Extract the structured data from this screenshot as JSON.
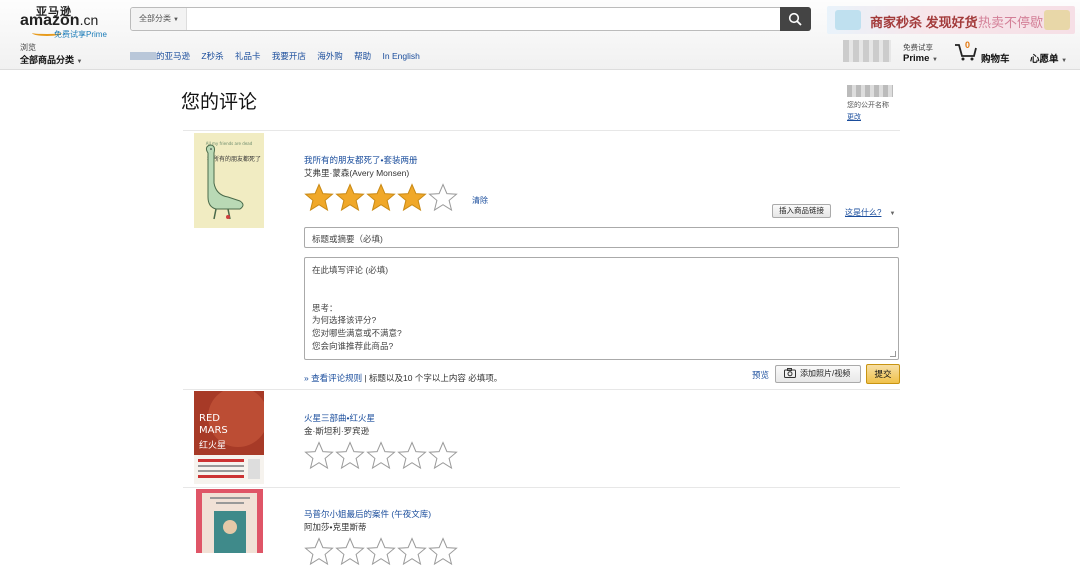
{
  "header": {
    "logo_cn": "亚马逊",
    "logo_brand": "amazon",
    "logo_tld": ".cn",
    "prime_trial": "免费试享Prime",
    "search_category": "全部分类",
    "search_placeholder": "",
    "banner_text_main": "商家秒杀 发现好货",
    "banner_text_sub": "热卖不停歇",
    "browse_small": "浏览",
    "browse_big": "全部商品分类",
    "nav_links": [
      "的亚马逊",
      "Z秒杀",
      "礼品卡",
      "我要开店",
      "海外购",
      "帮助",
      "In English"
    ],
    "prime_small": "免费试享",
    "prime_big": "Prime",
    "cart_count": "0",
    "cart_label": "购物车",
    "wishlist": "心愿单"
  },
  "page": {
    "title": "您的评论",
    "public_name_label": "您的公开名称",
    "public_name_edit": "更改"
  },
  "review_form": {
    "product_title": "我所有的朋友都死了•套装两册",
    "author": "艾弗里·蒙森(Avery Monsen)",
    "rating": 4,
    "max_rating": 5,
    "clear": "清除",
    "insert_link_button": "插入商品链接",
    "whats_this": "这是什么?",
    "title_placeholder": "标题或摘要（必填)",
    "body_lines": [
      "在此填写评论 (必填)",
      "",
      "",
      "思考：",
      "为何选择该评分?",
      "您对哪些满意或不满意?",
      "您会向谁推荐此商品?"
    ],
    "rules_link": "» 查看评论规则",
    "rules_text": "| 标题以及10 个字以上内容 必填项。",
    "preview": "预览",
    "add_photo_button": "添加照片/视频",
    "submit_button": "提交"
  },
  "products": [
    {
      "title": "火星三部曲•红火星",
      "author": "金·斯坦利·罗宾逊",
      "rating": 0
    },
    {
      "title": "马普尔小姐最后的案件 (午夜文库)",
      "author": "阿加莎•克里斯蒂",
      "rating": 0
    }
  ],
  "covers": {
    "book1_title": "我所有的朋友都死了",
    "book2_title_en": "RED MARS",
    "book2_title_cn": "红火星"
  },
  "colors": {
    "link": "#1a4d9c",
    "star_filled": "#f0a829",
    "submit": "#f0c14b",
    "brand_orange": "#e47911"
  }
}
